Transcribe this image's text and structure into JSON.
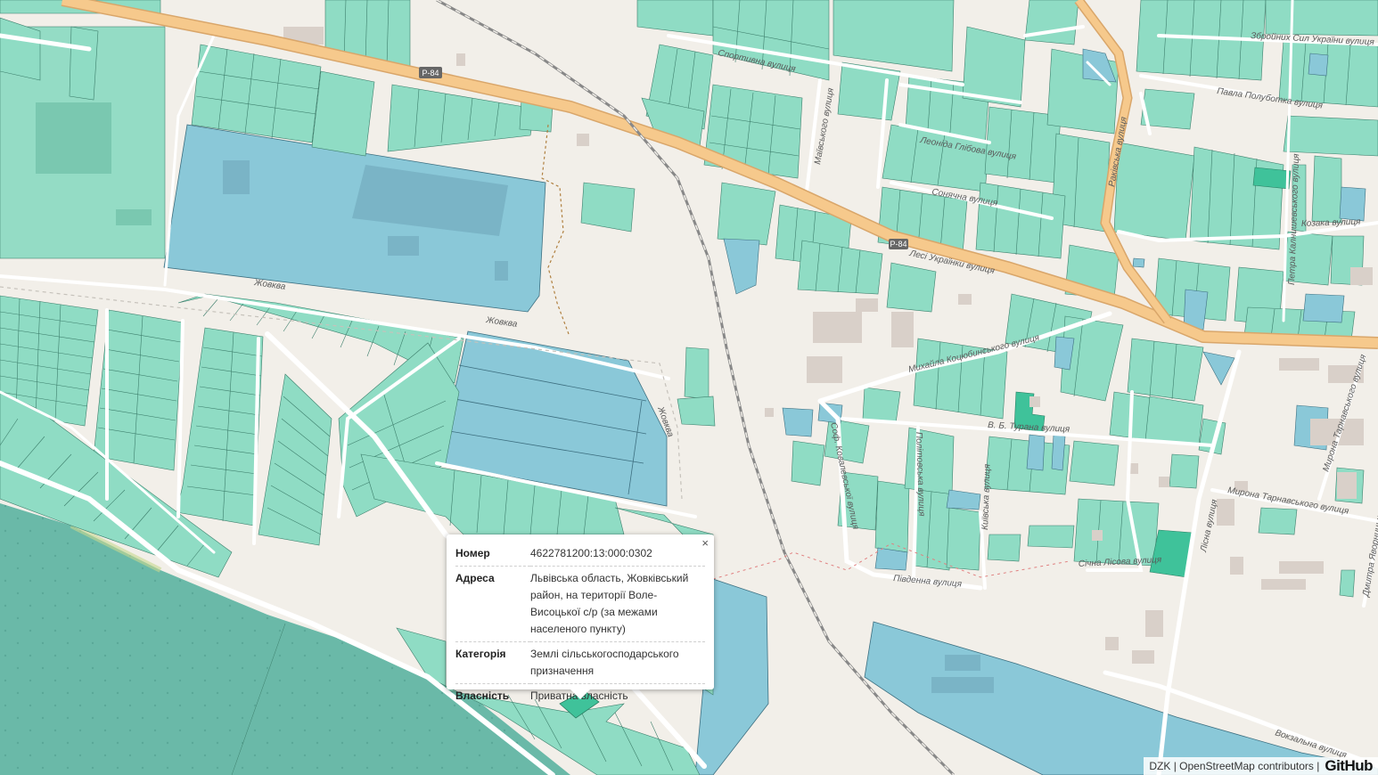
{
  "map": {
    "road_badge": "P-84",
    "streets": [
      "Спортивна вулиця",
      "Маївського вулиця",
      "Леоніда Глібова вулиця",
      "Сонячна вулиця",
      "Лесі Українки вулиця",
      "Раківська вулиця",
      "Збройних Сил України вулиця",
      "Павла Полуботка вулиця",
      "Козака вулиця",
      "Петра Калнишевського вулиця",
      "Михайла Коцюбинського вулиця",
      "В. Б. Турана вулиця",
      "Соф. Ковалевської вулиця",
      "Політовська вулиця",
      "Київська вулиця",
      "Південна вулиця",
      "Січна Лісова вулиця",
      "Лісна вулиця",
      "Мирона Тарнавського вулиця",
      "Мирона Тарнавського вулиця",
      "Дмитра Яворницького",
      "Вокзальна вулиця",
      "Жовква",
      "Жовква",
      "Жовква"
    ]
  },
  "popup": {
    "close_symbol": "×",
    "rows": [
      {
        "label": "Номер",
        "value": "4622781200:13:000:0302"
      },
      {
        "label": "Адреса",
        "value": "Львівська область, Жовківський район, на території Воле-Висоцької с/р (за межами населеного пункту)"
      },
      {
        "label": "Категорія",
        "value": "Землі сільськогосподарського призначення"
      },
      {
        "label": "Власність",
        "value": "Приватна власність"
      }
    ]
  },
  "attribution": {
    "text": "DZK | OpenStreetMap contributors |",
    "logo": "GitHub"
  },
  "colors": {
    "background": "#f2efe9",
    "parcel_green": "#8fdcc4",
    "parcel_blue": "#8ac8d8",
    "forest_dark": "#6ab9a8",
    "major_road": "#f6c98c",
    "railway": "#777777"
  }
}
